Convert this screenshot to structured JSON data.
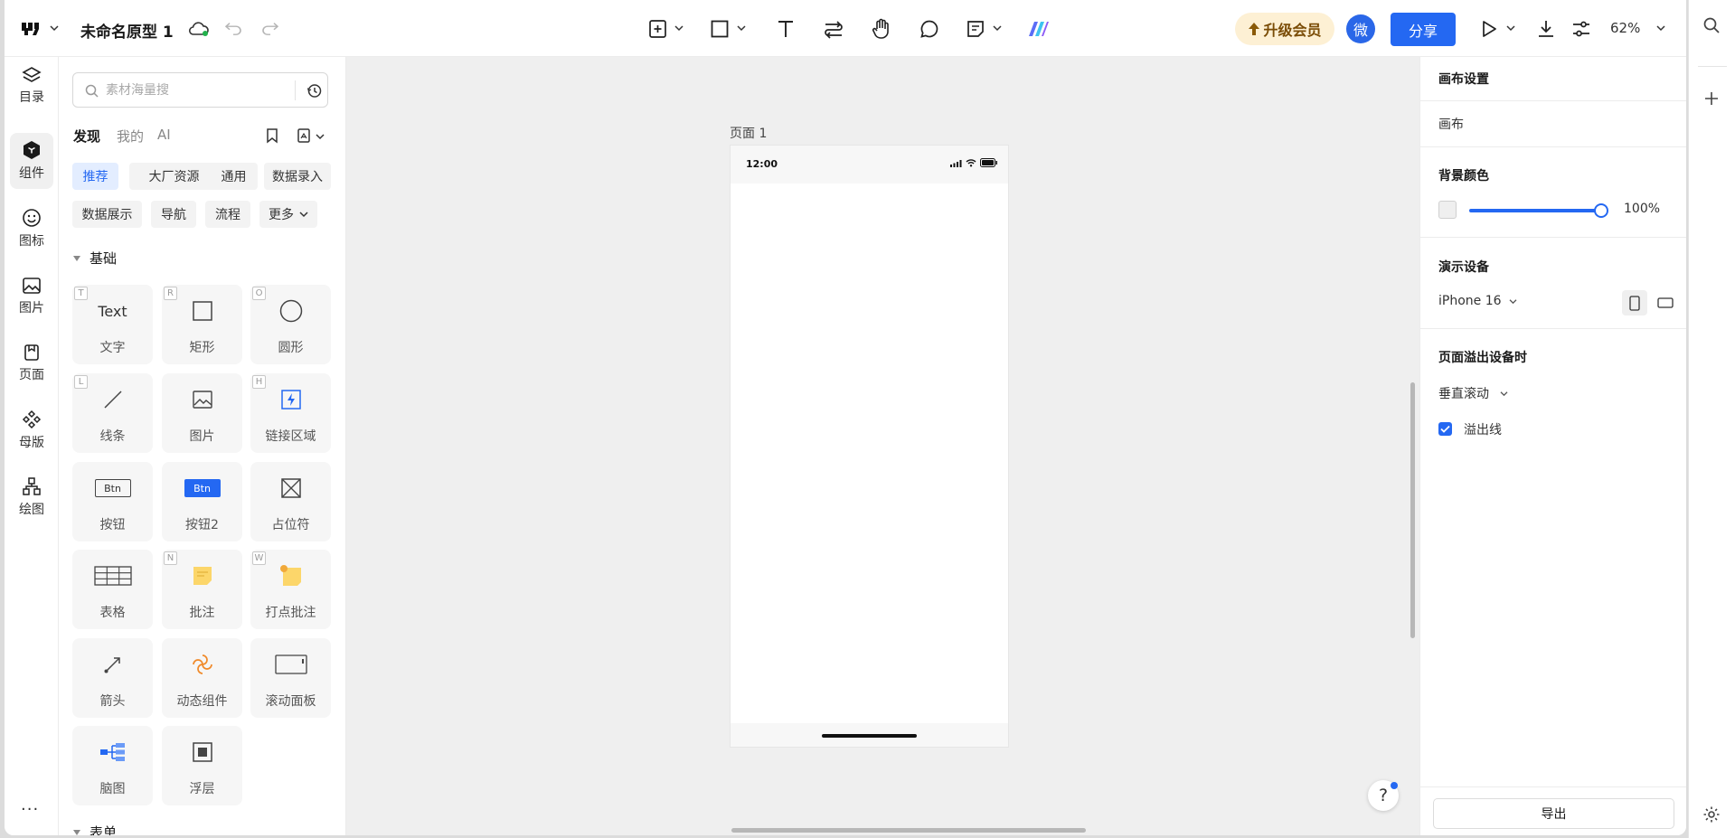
{
  "topbar": {
    "doc_title": "未命名原型 1",
    "upgrade_label": "升级会员",
    "avatar_text": "微",
    "share_label": "分享",
    "zoom": "62%"
  },
  "leftnav": {
    "items": [
      {
        "label": "目录"
      },
      {
        "label": "组件"
      },
      {
        "label": "图标"
      },
      {
        "label": "图片"
      },
      {
        "label": "页面"
      },
      {
        "label": "母版"
      },
      {
        "label": "绘图"
      }
    ],
    "more": "···"
  },
  "panel": {
    "search_placeholder": "素材海量搜",
    "tabs": [
      "发现",
      "我的",
      "AI"
    ],
    "chips": [
      "推荐",
      "大厂资源",
      "通用",
      "数据录入",
      "数据展示",
      "导航",
      "流程",
      "更多"
    ],
    "section_basic": "基础",
    "section_form": "表单",
    "components": [
      {
        "key": "T",
        "label": "文字",
        "icon_text": "Text"
      },
      {
        "key": "R",
        "label": "矩形"
      },
      {
        "key": "O",
        "label": "圆形"
      },
      {
        "key": "L",
        "label": "线条"
      },
      {
        "key": "",
        "label": "图片"
      },
      {
        "key": "H",
        "label": "链接区域"
      },
      {
        "key": "",
        "label": "按钮",
        "icon_text": "Btn"
      },
      {
        "key": "",
        "label": "按钮2",
        "icon_text": "Btn"
      },
      {
        "key": "",
        "label": "占位符"
      },
      {
        "key": "",
        "label": "表格"
      },
      {
        "key": "N",
        "label": "批注"
      },
      {
        "key": "W",
        "label": "打点批注"
      },
      {
        "key": "",
        "label": "箭头"
      },
      {
        "key": "",
        "label": "动态组件"
      },
      {
        "key": "",
        "label": "滚动面板"
      },
      {
        "key": "",
        "label": "脑图"
      },
      {
        "key": "",
        "label": "浮层"
      }
    ]
  },
  "canvas": {
    "page_label": "页面 1",
    "status_time": "12:00",
    "help": "?"
  },
  "rpanel": {
    "canvas_settings": "画布设置",
    "canvas": "画布",
    "bg_color_title": "背景颜色",
    "opacity": "100%",
    "device_title": "演示设备",
    "device": "iPhone 16",
    "overflow_title": "页面溢出设备时",
    "scroll_mode": "垂直滚动",
    "overflow_line": "溢出线",
    "export_label": "导出"
  },
  "colors": {
    "accent": "#2468f2",
    "upgrade_bg": "#fdf0d4",
    "canvas_bg": "#efefef"
  }
}
